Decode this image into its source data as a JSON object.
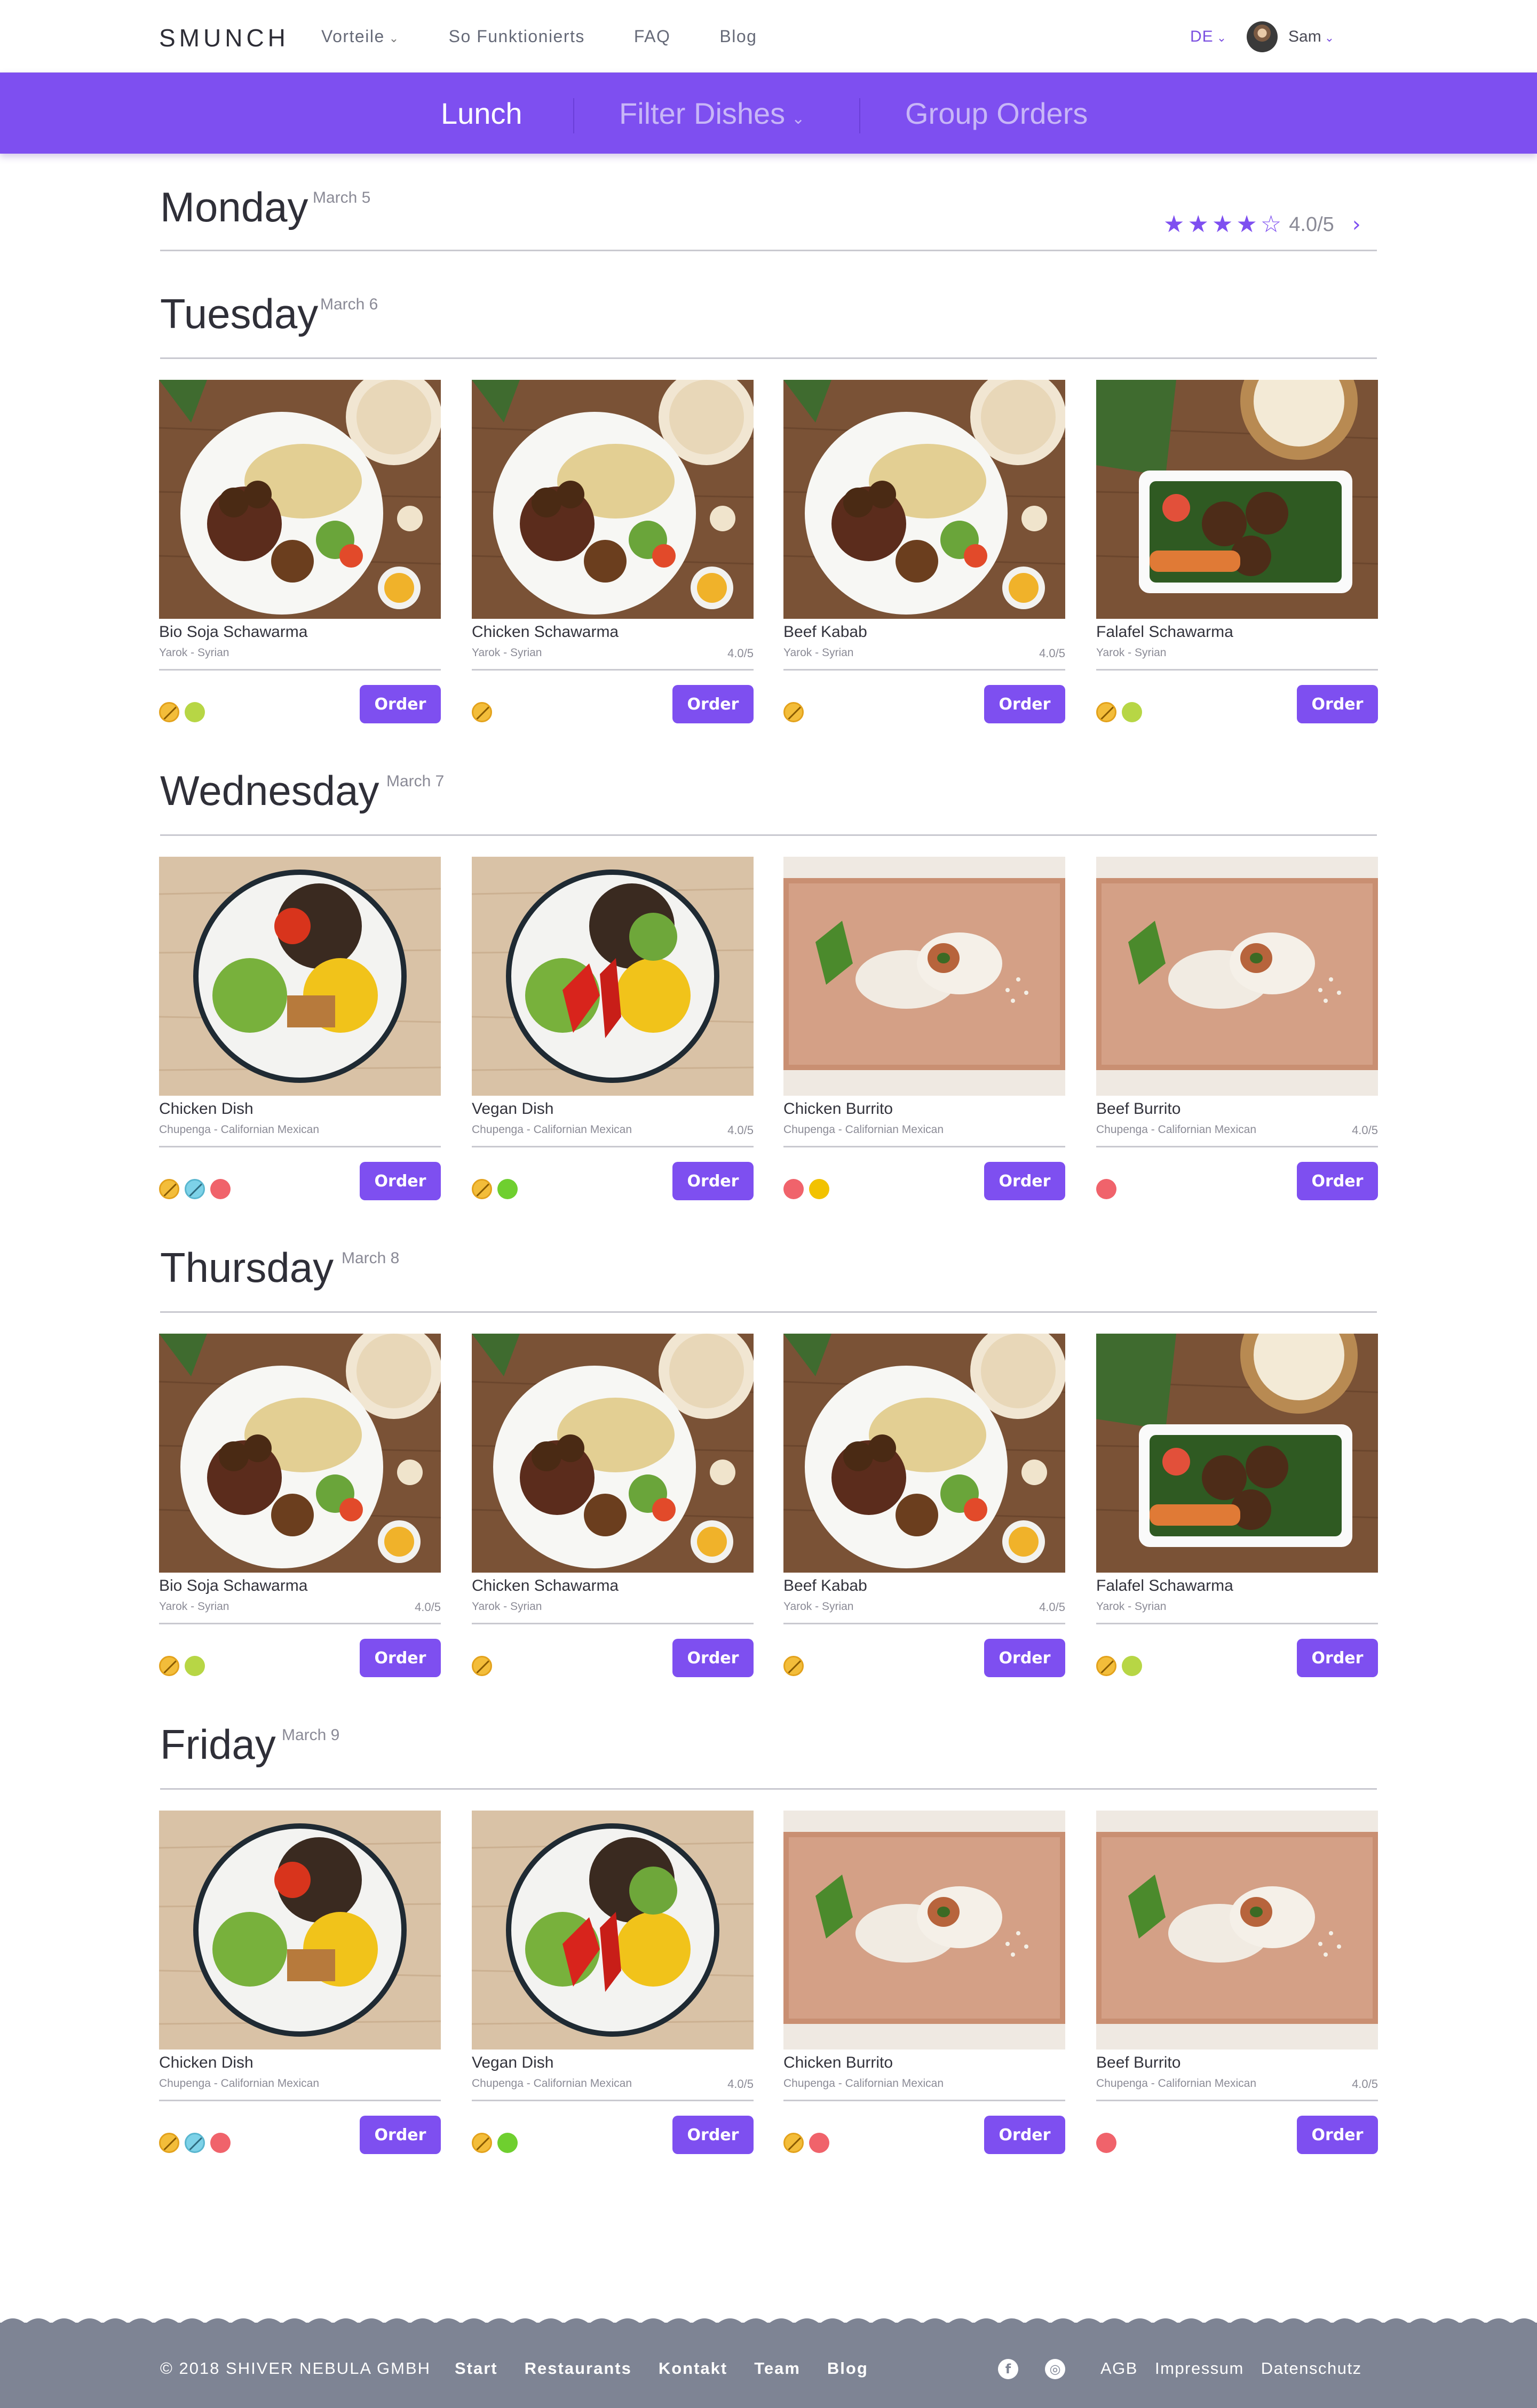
{
  "header": {
    "logo": "SMUNCH",
    "nav": [
      {
        "label": "Vorteile",
        "has_caret": true
      },
      {
        "label": "So Funktionierts"
      },
      {
        "label": "FAQ"
      },
      {
        "label": "Blog"
      }
    ],
    "language": "DE",
    "user_name": "Sam"
  },
  "menu_bar": {
    "lunch": "Lunch",
    "filter": "Filter Dishes",
    "group_orders": "Group Orders"
  },
  "days": [
    {
      "name": "Monday",
      "date": "March 5",
      "rating": "4.0/5",
      "stars_filled": 4,
      "stars_total": 5,
      "dishes": []
    },
    {
      "name": "Tuesday",
      "date": "March 6",
      "dishes": [
        {
          "name": "Bio Soja Schawarma",
          "restaurant": "Yarok - Syrian",
          "rating": "",
          "tags": [
            "gluten",
            "vegan"
          ],
          "photo": "syrian-plate-1"
        },
        {
          "name": "Chicken Schawarma",
          "restaurant": "Yarok - Syrian",
          "rating": "4.0/5",
          "tags": [
            "gluten"
          ],
          "photo": "syrian-plate-2"
        },
        {
          "name": "Beef Kabab",
          "restaurant": "Yarok - Syrian",
          "rating": "4.0/5",
          "tags": [
            "gluten"
          ],
          "photo": "syrian-plate-3"
        },
        {
          "name": "Falafel Schawarma",
          "restaurant": "Yarok - Syrian",
          "rating": "",
          "tags": [
            "gluten",
            "vegan"
          ],
          "photo": "falafel-box"
        }
      ]
    },
    {
      "name": "Wednesday",
      "date": "March 7",
      "dishes": [
        {
          "name": "Chicken Dish",
          "restaurant": "Chupenga - Californian Mexican",
          "rating": "",
          "tags": [
            "gluten",
            "lactose",
            "spicy"
          ],
          "photo": "bowl-chicken"
        },
        {
          "name": "Vegan Dish",
          "restaurant": "Chupenga - Californian Mexican",
          "rating": "4.0/5",
          "tags": [
            "gluten",
            "veggie"
          ],
          "photo": "bowl-vegan"
        },
        {
          "name": "Chicken Burrito",
          "restaurant": "Chupenga - Californian Mexican",
          "rating": "",
          "tags": [
            "spicy",
            "yellow"
          ],
          "photo": "burrito-1"
        },
        {
          "name": "Beef Burrito",
          "restaurant": "Chupenga - Californian Mexican",
          "rating": "4.0/5",
          "tags": [
            "spicy"
          ],
          "photo": "burrito-2"
        }
      ]
    },
    {
      "name": "Thursday",
      "date": "March 8",
      "dishes": [
        {
          "name": "Bio Soja Schawarma",
          "restaurant": "Yarok - Syrian",
          "rating": "4.0/5",
          "tags": [
            "gluten",
            "vegan"
          ],
          "photo": "syrian-plate-1"
        },
        {
          "name": "Chicken Schawarma",
          "restaurant": "Yarok - Syrian",
          "rating": "",
          "tags": [
            "gluten"
          ],
          "photo": "syrian-plate-2"
        },
        {
          "name": "Beef Kabab",
          "restaurant": "Yarok - Syrian",
          "rating": "4.0/5",
          "tags": [
            "gluten"
          ],
          "photo": "syrian-plate-3"
        },
        {
          "name": "Falafel Schawarma",
          "restaurant": "Yarok - Syrian",
          "rating": "",
          "tags": [
            "gluten",
            "vegan"
          ],
          "photo": "falafel-box"
        }
      ]
    },
    {
      "name": "Friday",
      "date": "March 9",
      "dishes": [
        {
          "name": "Chicken Dish",
          "restaurant": "Chupenga - Californian Mexican",
          "rating": "",
          "tags": [
            "gluten",
            "lactose",
            "spicy"
          ],
          "photo": "bowl-chicken"
        },
        {
          "name": "Vegan Dish",
          "restaurant": "Chupenga - Californian Mexican",
          "rating": "4.0/5",
          "tags": [
            "gluten",
            "veggie"
          ],
          "photo": "bowl-vegan"
        },
        {
          "name": "Chicken Burrito",
          "restaurant": "Chupenga - Californian Mexican",
          "rating": "",
          "tags": [
            "gluten",
            "spicy"
          ],
          "photo": "burrito-1"
        },
        {
          "name": "Beef Burrito",
          "restaurant": "Chupenga - Californian Mexican",
          "rating": "4.0/5",
          "tags": [
            "spicy"
          ],
          "photo": "burrito-2"
        }
      ]
    }
  ],
  "order_label": "Order",
  "footer": {
    "copyright": "© 2018 SHIVER NEBULA GMBH",
    "nav": [
      "Start",
      "Restaurants",
      "Kontakt",
      "Team",
      "Blog"
    ],
    "social": [
      "facebook-icon",
      "instagram-icon"
    ],
    "legal": [
      "AGB",
      "Impressum",
      "Datenschutz"
    ]
  },
  "colors": {
    "accent": "#7e4ff0",
    "footer": "#7e8494"
  }
}
